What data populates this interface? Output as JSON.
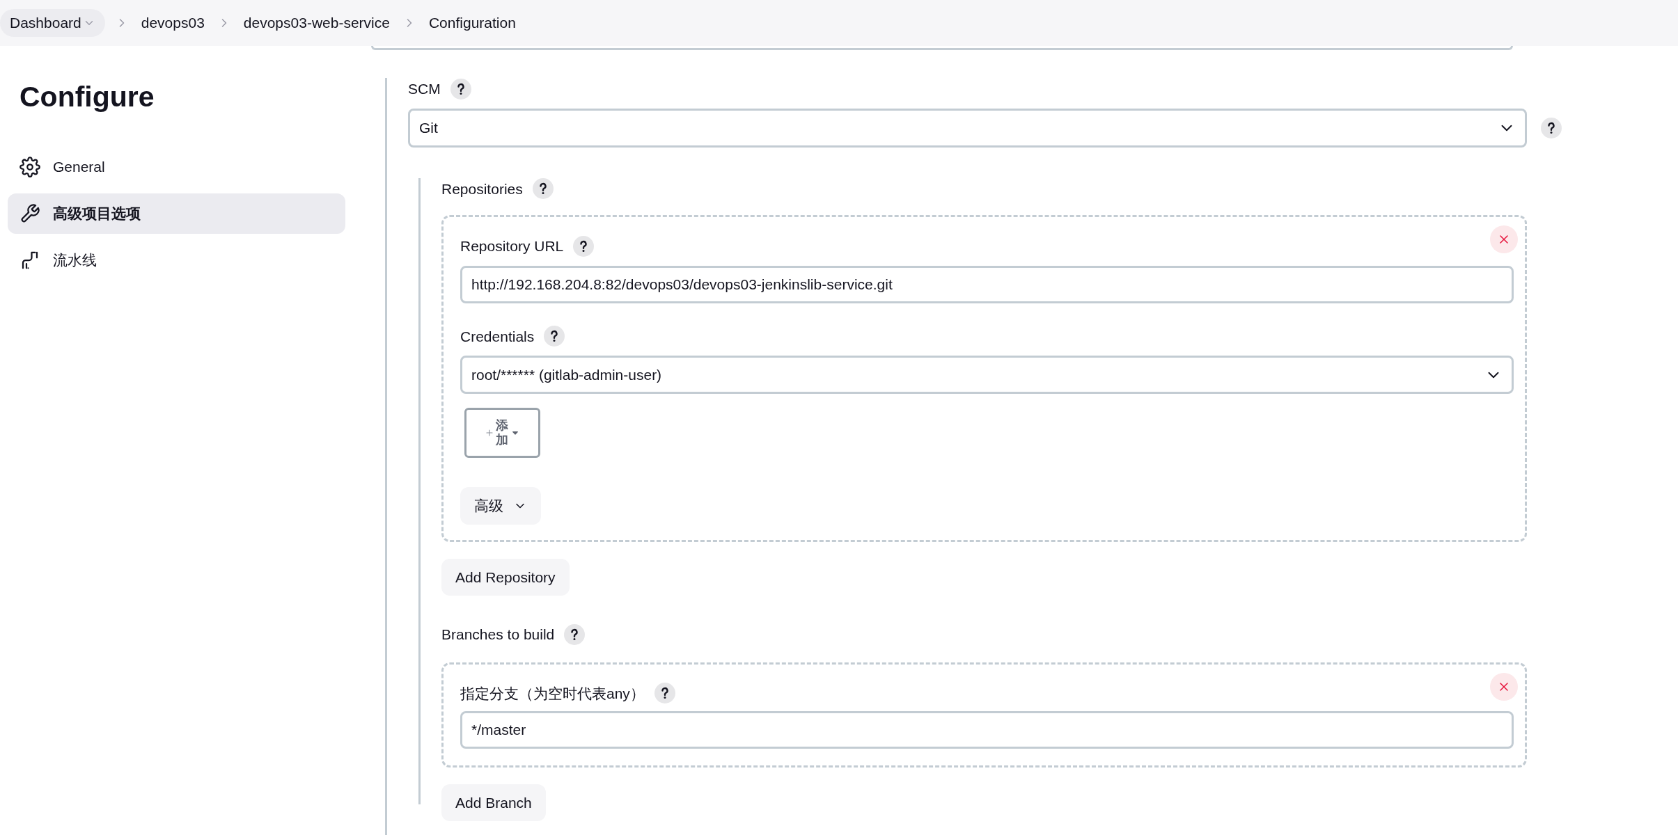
{
  "breadcrumb": [
    {
      "label": "Dashboard",
      "kind": "dropdown"
    },
    {
      "label": "devops03",
      "kind": "link"
    },
    {
      "label": "devops03-web-service",
      "kind": "link"
    },
    {
      "label": "Configuration",
      "kind": "link"
    }
  ],
  "sidebar": {
    "title": "Configure",
    "items": [
      {
        "label": "General",
        "selected": false
      },
      {
        "label": "高级项目选项",
        "selected": true
      },
      {
        "label": "流水线",
        "selected": false
      }
    ]
  },
  "scm": {
    "label": "SCM",
    "value": "Git"
  },
  "repositories": {
    "label": "Repositories",
    "items": [
      {
        "url_label": "Repository URL",
        "url": "http://192.168.204.8:82/devops03/devops03-jenkinslib-service.git",
        "credentials_label": "Credentials",
        "credentials": "root/****** (gitlab-admin-user)",
        "add_button": "添加",
        "advanced_button": "高级"
      }
    ],
    "add_button": "Add Repository"
  },
  "branches": {
    "label": "Branches to build",
    "items": [
      {
        "label": "指定分支（为空时代表any）",
        "value": "*/master"
      }
    ],
    "add_button": "Add Branch"
  }
}
